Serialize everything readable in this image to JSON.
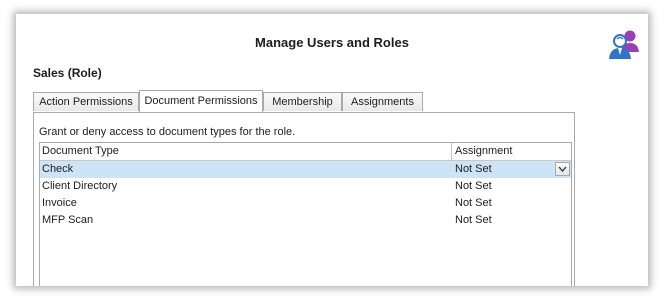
{
  "window": {
    "title": "Manage Users and Roles",
    "icon": "users-icon"
  },
  "role": {
    "heading": "Sales (Role)"
  },
  "tabs": [
    {
      "label": "Action Permissions",
      "active": false
    },
    {
      "label": "Document Permissions",
      "active": true
    },
    {
      "label": "Membership",
      "active": false
    },
    {
      "label": "Assignments",
      "active": false
    }
  ],
  "panel": {
    "description": "Grant or deny access to document types for the role.",
    "columns": {
      "document_type": "Document Type",
      "assignment": "Assignment"
    },
    "rows": [
      {
        "document_type": "Check",
        "assignment": "Not Set",
        "selected": true
      },
      {
        "document_type": "Client Directory",
        "assignment": "Not Set",
        "selected": false
      },
      {
        "document_type": "Invoice",
        "assignment": "Not Set",
        "selected": false
      },
      {
        "document_type": "MFP Scan",
        "assignment": "Not Set",
        "selected": false
      }
    ]
  },
  "colors": {
    "selected_row": "#cde4f7",
    "icon_blue": "#2e74c9",
    "icon_purple": "#9b3fb8"
  }
}
